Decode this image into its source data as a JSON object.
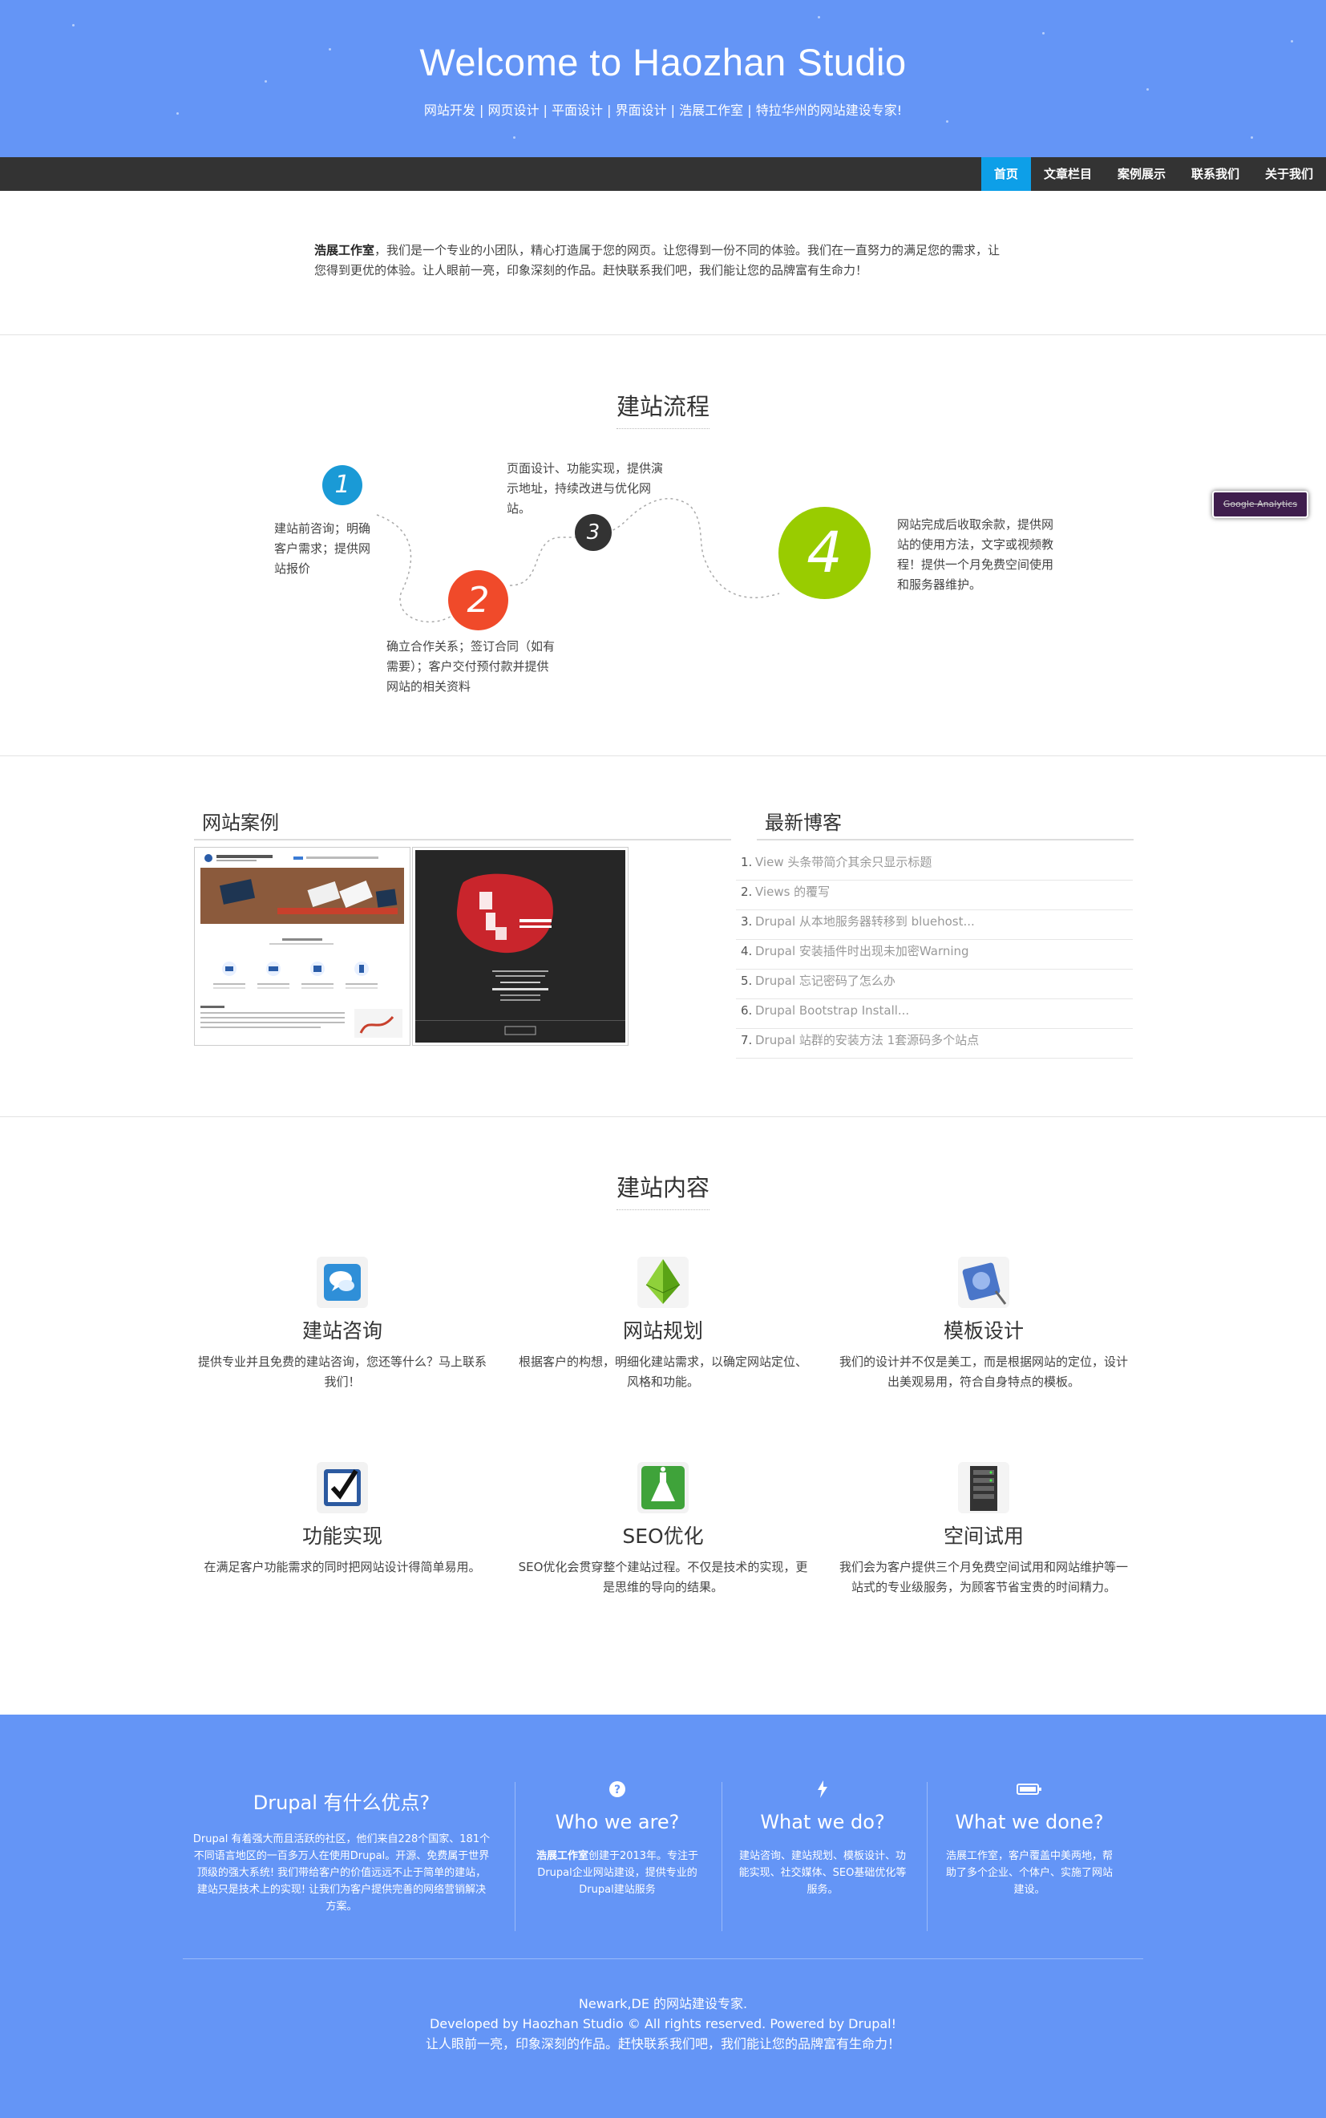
{
  "header": {
    "title": "Welcome to Haozhan Studio",
    "subtitle": "网站开发 | 网页设计 | 平面设计 | 界面设计 | 浩展工作室 | 特拉华州的网站建设专家!"
  },
  "nav": {
    "items": [
      {
        "label": "首页",
        "active": true
      },
      {
        "label": "文章栏目",
        "active": false
      },
      {
        "label": "案例展示",
        "active": false
      },
      {
        "label": "联系我们",
        "active": false
      },
      {
        "label": "关于我们",
        "active": false
      }
    ]
  },
  "intro": {
    "brand": "浩展工作室",
    "text": "，我们是一个专业的小团队，精心打造属于您的网页。让您得到一份不同的体验。我们在一直努力的满足您的需求，让您得到更优的体验。让人眼前一亮，印象深刻的作品。赶快联系我们吧，我们能让您的品牌富有生命力！"
  },
  "process": {
    "title": "建站流程",
    "steps": [
      {
        "number": "1",
        "text": "建站前咨询；明确客户需求；提供网站报价",
        "color": "#1a9ad6"
      },
      {
        "number": "2",
        "text": "确立合作关系；签订合同（如有需要）；客户交付预付款并提供网站的相关资料",
        "color": "#f04a2a"
      },
      {
        "number": "3",
        "text": "页面设计、功能实现，提供演示地址，持续改进与优化网站。",
        "color": "#333333"
      },
      {
        "number": "4",
        "text": "网站完成后收取余款，提供网站的使用方法，文字或视频教程！提供一个月免费空间使用和服务器维护。",
        "color": "#99cc00"
      }
    ]
  },
  "cases": {
    "title": "网站案例"
  },
  "blog": {
    "title": "最新博客",
    "items": [
      {
        "num": "1.",
        "label": "View 头条带简介其余只显示标题"
      },
      {
        "num": "2.",
        "label": "Views 的覆写"
      },
      {
        "num": "3.",
        "label": "Drupal 从本地服务器转移到 bluehost..."
      },
      {
        "num": "4.",
        "label": "Drupal 安装插件时出现未加密Warning"
      },
      {
        "num": "5.",
        "label": "Drupal 忘记密码了怎么办"
      },
      {
        "num": "6.",
        "label": "Drupal Bootstrap Install..."
      },
      {
        "num": "7.",
        "label": "Drupal 站群的安装方法 1套源码多个站点"
      }
    ]
  },
  "services": {
    "title": "建站内容",
    "items": [
      {
        "title": "建站咨询",
        "desc": "提供专业并且免费的建站咨询，您还等什么？马上联系我们！",
        "icon": "chat-bubble-icon"
      },
      {
        "title": "网站规划",
        "desc": "根据客户的构想，明细化建站需求，以确定网站定位、风格和功能。",
        "icon": "pyramid-icon"
      },
      {
        "title": "模板设计",
        "desc": "我们的设计并不仅是美工，而是根据网站的定位，设计出美观易用，符合自身特点的模板。",
        "icon": "design-icon"
      },
      {
        "title": "功能实现",
        "desc": "在满足客户功能需求的同时把网站设计得简单易用。",
        "icon": "checkbox-icon"
      },
      {
        "title": "SEO优化",
        "desc": "SEO优化会贯穿整个建站过程。不仅是技术的实现，更是思维的导向的结果。",
        "icon": "flask-icon"
      },
      {
        "title": "空间试用",
        "desc": "我们会为客户提供三个月免费空间试用和网站维护等一站式的专业级服务，为顾客节省宝贵的时间精力。",
        "icon": "server-icon"
      }
    ]
  },
  "footer": {
    "col1": {
      "title": "Drupal 有什么优点?",
      "text": "Drupal 有着强大而且活跃的社区，他们来自228个国家、181个不同语言地区的一百多万人在使用Drupal。开源、免费属于世界顶级的强大系统! 我们带给客户的价值远远不止于简单的建站，建站只是技术上的实现! 让我们为客户提供完善的网络营销解决方案。"
    },
    "col2": {
      "icon": "question-circle-icon",
      "title": "Who we are?",
      "brand": "浩展工作室",
      "text": "创建于2013年。专注于Drupal企业网站建设，提供专业的Drupal建站服务"
    },
    "col3": {
      "icon": "bolt-icon",
      "title": "What we do?",
      "text": "建站咨询、建站规划、模板设计、功能实现、社交媒体、SEO基础优化等服务。"
    },
    "col4": {
      "icon": "battery-icon",
      "title": "What we done?",
      "text": "浩展工作室，客户覆盖中美两地，帮助了多个企业、个体户、实施了网站建设。"
    },
    "bottom": {
      "line1": "Newark,DE 的网站建设专家.",
      "line2": "Developed by Haozhan Studio © All rights reserved. Powered by Drupal!",
      "line3": "让人眼前一亮，印象深刻的作品。赶快联系我们吧，我们能让您的品牌富有生命力！"
    }
  },
  "google_analytics": {
    "label": "Google Analytics"
  },
  "colors": {
    "brand_blue": "#6495f6",
    "nav_dark": "#333333",
    "nav_active": "#0d9fe8"
  }
}
